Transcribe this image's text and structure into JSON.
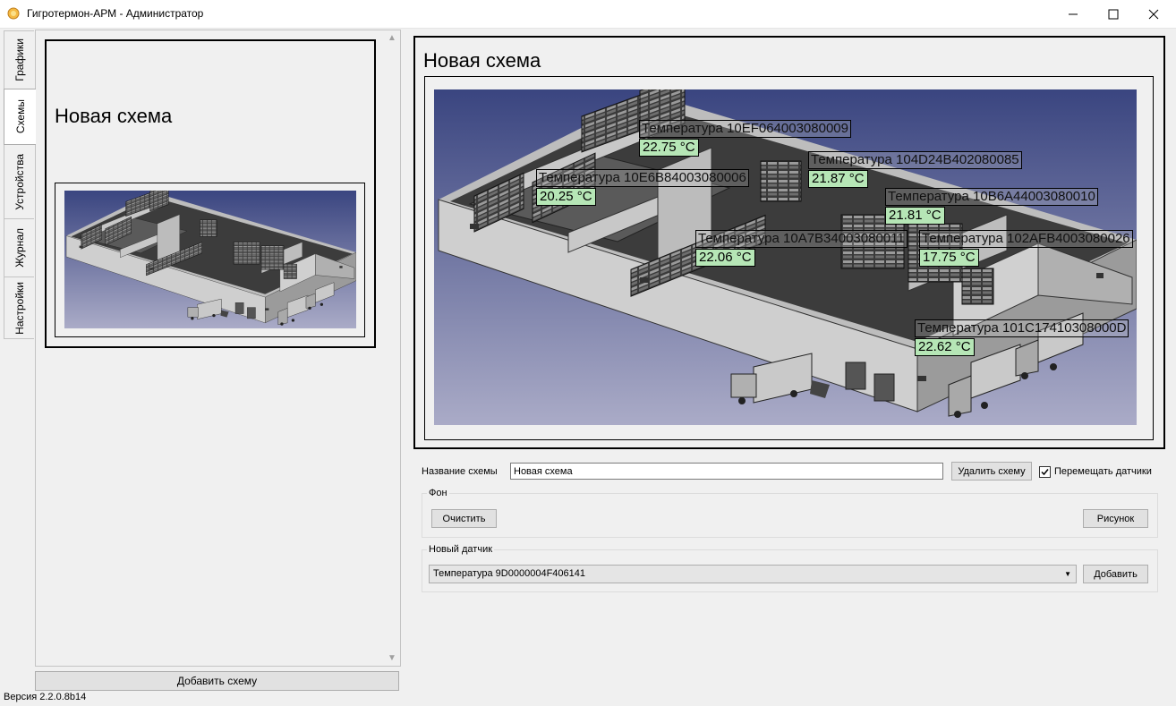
{
  "window": {
    "title": "Гигротермон-АРМ - Администратор",
    "controls": [
      "minimize",
      "maximize",
      "close"
    ]
  },
  "tabs": [
    {
      "label": "Графики",
      "active": false
    },
    {
      "label": "Схемы",
      "active": true
    },
    {
      "label": "Устройства",
      "active": false
    },
    {
      "label": "Журнал",
      "active": false
    },
    {
      "label": "Настройки",
      "active": false
    }
  ],
  "scheme_list": {
    "items": [
      {
        "title": "Новая схема"
      }
    ],
    "add_button": "Добавить схему"
  },
  "scheme_preview": {
    "title": "Новая схема",
    "sensors": [
      {
        "name": "Температура 10EF064003080009",
        "value": "22.75 °C"
      },
      {
        "name": "Температура 104D24B402080085",
        "value": "21.87 °C"
      },
      {
        "name": "Температура 10E6B84003080006",
        "value": "20.25 °C"
      },
      {
        "name": "Температура 10B6A44003080010",
        "value": "21.81 °C"
      },
      {
        "name": "Температура 10A7B34003080011",
        "value": "22.06 °C"
      },
      {
        "name": "Температура 102AFB4003080026",
        "value": "17.75 °C"
      },
      {
        "name": "Температура 101C17410308000D",
        "value": "22.62 °C"
      }
    ]
  },
  "form": {
    "name_label": "Название схемы",
    "name_value": "Новая схема",
    "delete_button": "Удалить схему",
    "move_sensors_label": "Перемещать датчики",
    "move_sensors_checked": true,
    "background_group": "Фон",
    "clear_button": "Очистить",
    "picture_button": "Рисунок",
    "new_sensor_group": "Новый датчик",
    "new_sensor_value": "Температура 9D0000004F406141",
    "add_button": "Добавить"
  },
  "version": "Версия 2.2.0.8b14",
  "colors": {
    "value_bg": "#b6e6b6",
    "scene_top": "#3a4580",
    "scene_bottom": "#a9aac6"
  }
}
